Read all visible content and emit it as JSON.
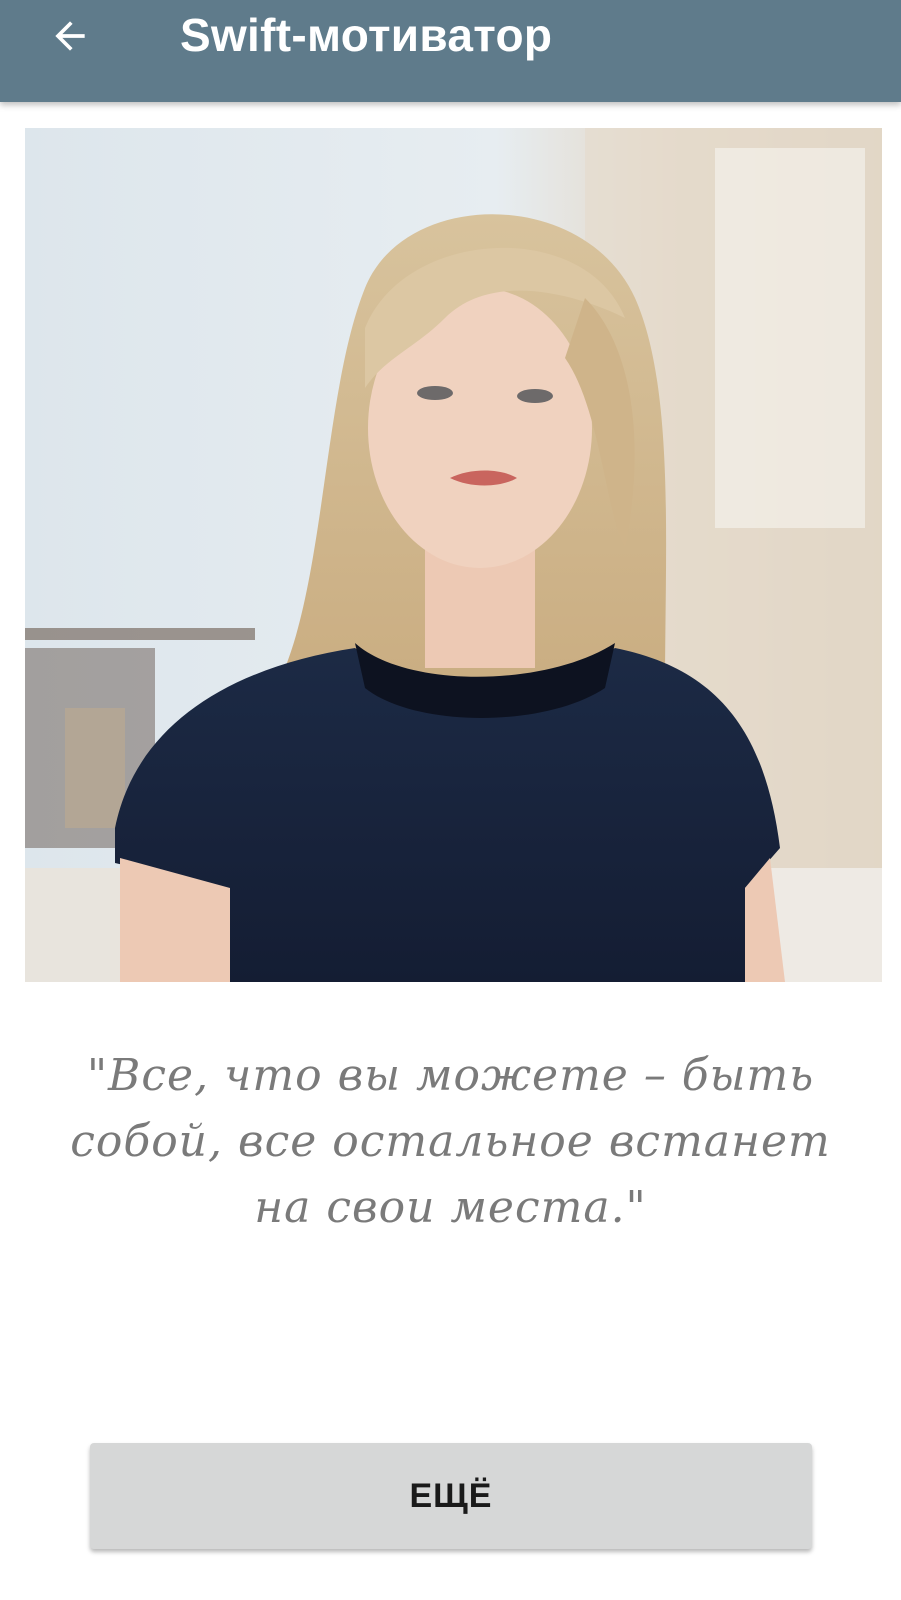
{
  "toolbar": {
    "back_icon": "arrow-left-icon",
    "title": "Swift-мотиватор",
    "background_color": "#5f7b8b"
  },
  "photo": {
    "description_icon": "photo-image"
  },
  "quote": {
    "text": "\"Все, что вы можете – быть собой, все остальное встанет на свои места.\""
  },
  "actions": {
    "more_label": "ЕЩЁ"
  }
}
